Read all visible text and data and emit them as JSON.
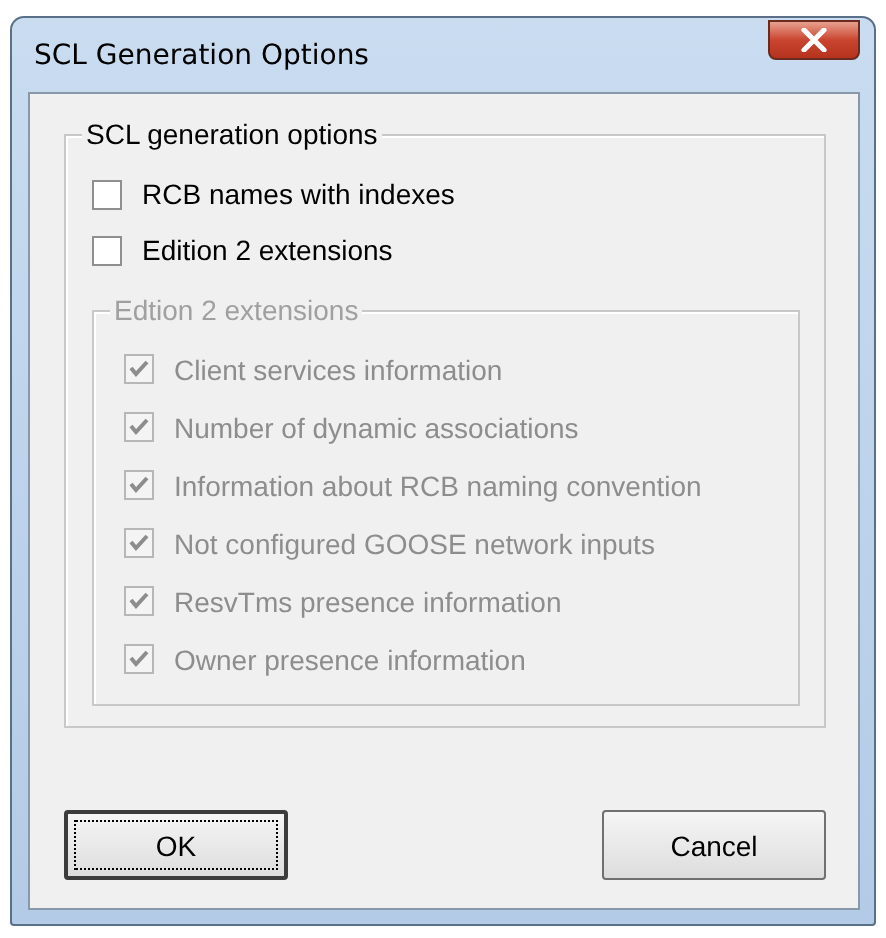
{
  "window": {
    "title": "SCL Generation Options"
  },
  "group": {
    "title": "SCL generation options",
    "options": [
      {
        "label": "RCB names with indexes",
        "checked": false,
        "disabled": false
      },
      {
        "label": "Edition 2 extensions",
        "checked": false,
        "disabled": false
      }
    ]
  },
  "subgroup": {
    "title": "Edtion 2 extensions",
    "disabled": true,
    "options": [
      {
        "label": "Client services information",
        "checked": true,
        "disabled": true
      },
      {
        "label": "Number of dynamic associations",
        "checked": true,
        "disabled": true
      },
      {
        "label": "Information about RCB naming convention",
        "checked": true,
        "disabled": true
      },
      {
        "label": "Not configured GOOSE network inputs",
        "checked": true,
        "disabled": true
      },
      {
        "label": "ResvTms presence information",
        "checked": true,
        "disabled": true
      },
      {
        "label": "Owner presence information",
        "checked": true,
        "disabled": true
      }
    ]
  },
  "buttons": [
    {
      "label": "OK",
      "default": true
    },
    {
      "label": "Cancel",
      "default": false
    }
  ]
}
